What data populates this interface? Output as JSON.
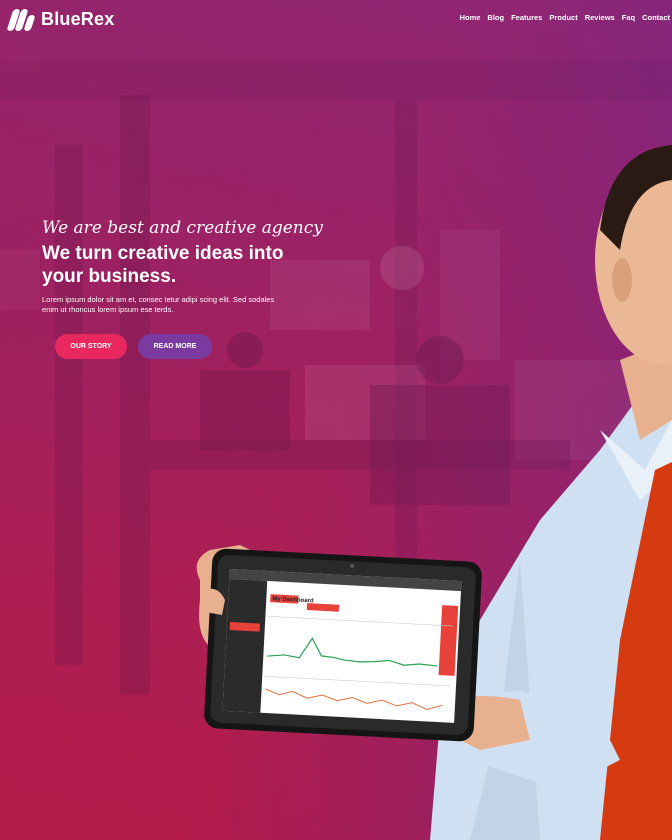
{
  "brand": {
    "name": "BlueRex"
  },
  "nav": {
    "items": [
      {
        "label": "Home"
      },
      {
        "label": "Blog"
      },
      {
        "label": "Features"
      },
      {
        "label": "Product"
      },
      {
        "label": "Reviews"
      },
      {
        "label": "Faq"
      },
      {
        "label": "Contact"
      }
    ]
  },
  "hero": {
    "tagline": "We are best and creative agency",
    "headline": "We turn creative ideas into your business.",
    "description": "Lorem ipsum dolor sit am et, consec tetur adipi scing elit. Sed sodales enim ut rhoncus lorem ipsum ese terds.",
    "primary_button": "OUR STORY",
    "secondary_button": "READ MORE"
  },
  "tablet_screen": {
    "title": "My Dashboard"
  },
  "colors": {
    "primary_button": "#e8285f",
    "secondary_button": "#7b3aa0",
    "hero_top": "#8a2a7a",
    "hero_bottom": "#c01a3a",
    "tie": "#d63a10",
    "shirt": "#cfe0f2"
  }
}
